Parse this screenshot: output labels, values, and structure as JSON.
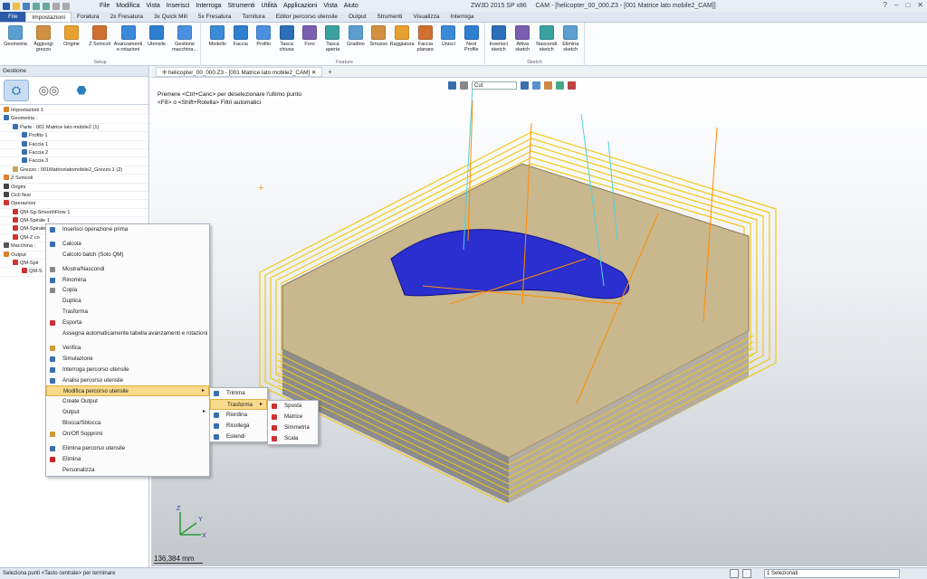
{
  "app": {
    "title": "ZW3D 2015 SP x86",
    "window_title": "CAM - [helicopter_00_000.Z3 - [001 Matrice lato mobile2_CAM]]",
    "menu": [
      "File",
      "Modifica",
      "Vista",
      "Inserisci",
      "Interroga",
      "Strumenti",
      "Utilità",
      "Applicazioni",
      "Vista",
      "Aiuto"
    ]
  },
  "ribbon_tabs": [
    "File",
    "Impostazioni",
    "Foratura",
    "2x Fresatura",
    "3x Quick Mill",
    "5x Fresatura",
    "Tornitura",
    "Editor percorso utensile",
    "Output",
    "Strumenti",
    "Visualizza",
    "Interroga"
  ],
  "ribbon": {
    "setup": {
      "name": "Setup",
      "buttons": [
        "Geometria",
        "Aggiungi grezzo",
        "Origine",
        "Z Svincoli",
        "Avanzamenti e rotazioni",
        "Utensile",
        "Gestione macchina..."
      ]
    },
    "feature": {
      "name": "Feature",
      "buttons": [
        "Modello",
        "Faccia",
        "Profilo",
        "Tasca chiusa",
        "Foro",
        "Tasca aperta",
        "Gradino",
        "Smusso",
        "Raggiatura",
        "Faccia planare",
        "Unisci",
        "Nest Profile"
      ]
    },
    "sketch": {
      "name": "Sketch",
      "buttons": [
        "Inserisci sketch",
        "Attiva sketch",
        "Nascondi sketch",
        "Elimina sketch"
      ]
    }
  },
  "panel": {
    "title": "Gestione",
    "tree": [
      {
        "label": "Impostazioni 1",
        "depth": 0,
        "icon": "#d9822b"
      },
      {
        "label": "Geometria :",
        "depth": 0,
        "icon": "#3a6fb0"
      },
      {
        "label": "Parte : 001 Matrice lato mobile2 (1)",
        "depth": 1,
        "icon": "#3a6fb0"
      },
      {
        "label": "Profilo 1",
        "depth": 2,
        "icon": "#3a6fb0"
      },
      {
        "label": "Faccia 1",
        "depth": 2,
        "icon": "#3a6fb0"
      },
      {
        "label": "Faccia 2",
        "depth": 2,
        "icon": "#3a6fb0"
      },
      {
        "label": "Faccia 3",
        "depth": 2,
        "icon": "#3a6fb0"
      },
      {
        "label": "Grezzo : 001Matricelatomobile2_Grezzo.1 (2)",
        "depth": 1,
        "icon": "#c9a55a"
      },
      {
        "label": "Z Svincoli",
        "depth": 0,
        "icon": "#d9822b"
      },
      {
        "label": "Origini",
        "depth": 0,
        "icon": "#444444"
      },
      {
        "label": "Cicli fissi",
        "depth": 0,
        "icon": "#444444"
      },
      {
        "label": "Operazioni",
        "depth": 0,
        "icon": "#cc3333"
      },
      {
        "label": "QM-Sg-SmoothFlow 1",
        "depth": 1,
        "icon": "#cc3333"
      },
      {
        "label": "QM-Spirale 1",
        "depth": 1,
        "icon": "#cc3333"
      },
      {
        "label": "QM-Spirale 2",
        "depth": 1,
        "icon": "#cc3333"
      },
      {
        "label": "QM-Z co",
        "depth": 1,
        "icon": "#cc3333"
      },
      {
        "label": "Macchina :",
        "depth": 0,
        "icon": "#555555"
      },
      {
        "label": "Output",
        "depth": 0,
        "icon": "#d9822b"
      },
      {
        "label": "QM-Spir",
        "depth": 1,
        "icon": "#cc3333"
      },
      {
        "label": "QM-S",
        "depth": 2,
        "icon": "#cc3333"
      }
    ]
  },
  "document_tab": "helicopter_00_000.Z3 - [001 Matrice lato mobile2_CAM]",
  "viewport": {
    "hint_line1": "Premere <Ctrl+Canc> per deselezionare l'ultimo punto",
    "hint_line2": "<F8> o <Shift+Rotella> Filtri automatici",
    "filter_value": "Cut",
    "scale": "136,384 mm"
  },
  "context_menu": [
    {
      "label": "Inserisci operazione prima",
      "icon": "#3a6fb0"
    },
    {
      "sep": true
    },
    {
      "label": "Calcola",
      "icon": "#3a6fb0"
    },
    {
      "label": "Calcolo batch (Solo QM)",
      "icon": ""
    },
    {
      "sep": true
    },
    {
      "label": "Mostra/Nascondi",
      "icon": "#888888"
    },
    {
      "label": "Rinomina",
      "icon": "#3a6fb0"
    },
    {
      "label": "Copia",
      "icon": "#888888"
    },
    {
      "label": "Duplica",
      "icon": ""
    },
    {
      "label": "Trasforma",
      "icon": ""
    },
    {
      "label": "Esporta",
      "icon": "#cc3333"
    },
    {
      "label": "Assegna automaticamente tabella avanzamenti e rotazioni",
      "icon": ""
    },
    {
      "sep": true
    },
    {
      "label": "Verifica",
      "icon": "#cc9933"
    },
    {
      "label": "Simulazione",
      "icon": "#3a6fb0"
    },
    {
      "label": "Interroga percorso utensile",
      "icon": "#3a6fb0"
    },
    {
      "label": "Analisi percorso utensile",
      "icon": "#3a6fb0"
    },
    {
      "label": "Modifica percorso utensile",
      "icon": "",
      "submenu": true,
      "highlight": true
    },
    {
      "label": "Create Output",
      "icon": ""
    },
    {
      "label": "Output",
      "icon": "",
      "submenu": true
    },
    {
      "label": "Blocca/Sblocca",
      "icon": ""
    },
    {
      "label": "On/Off Sopprimi",
      "icon": "#cc9933"
    },
    {
      "sep": true
    },
    {
      "label": "Elimina percorso utensile",
      "icon": "#3a6fb0"
    },
    {
      "label": "Elimina",
      "icon": "#cc2222"
    },
    {
      "label": "Personalizza",
      "icon": ""
    }
  ],
  "submenu_modify": [
    {
      "label": "Trimma",
      "icon": "#3a6fb0"
    },
    {
      "label": "Trasforma",
      "icon": "",
      "submenu": true,
      "highlight": true
    },
    {
      "label": "Riordina",
      "icon": "#3a6fb0"
    },
    {
      "label": "Ricollega",
      "icon": "#3a6fb0"
    },
    {
      "label": "Estendi",
      "icon": "#3a6fb0"
    }
  ],
  "submenu_transform": [
    {
      "label": "Sposta",
      "icon": "#cc3333"
    },
    {
      "label": "Matrice",
      "icon": "#cc3333"
    },
    {
      "label": "Simmetria",
      "icon": "#cc3333"
    },
    {
      "label": "Scala",
      "icon": "#cc3333"
    }
  ],
  "statusbar": {
    "text": "Seleziona punti <Tasto centrale> per terminare",
    "selection": "1 Selezionati"
  }
}
